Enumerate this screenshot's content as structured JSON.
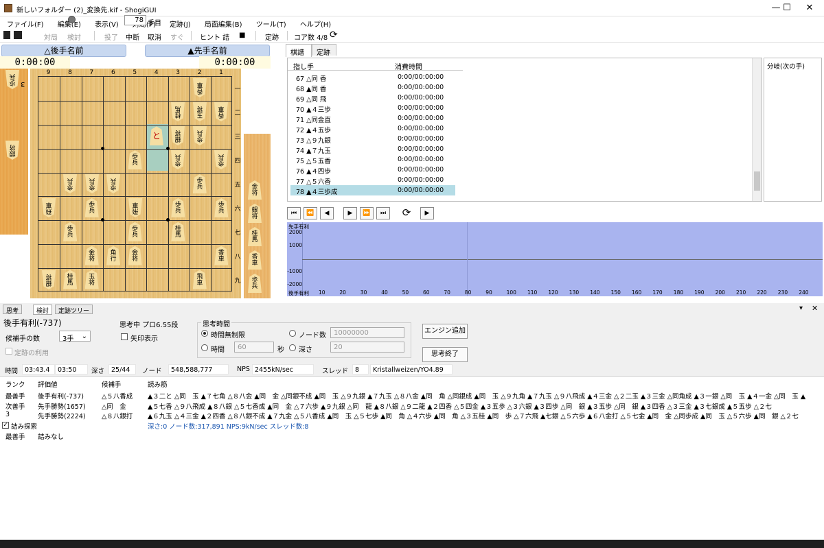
{
  "window": {
    "title": "新しいフォルダー (2)_変換先.kif - ShogiGUI",
    "minimize": "—",
    "maximize": "☐",
    "close": "✕"
  },
  "menu": [
    "ファイル(F)",
    "編集(E)",
    "表示(V)",
    "対局(P)",
    "定跡(J)",
    "局面編集(B)",
    "ツール(T)",
    "ヘルプ(H)"
  ],
  "toolbar": {
    "taikyoku": "対局",
    "kento": "検討",
    "toryo": "投了",
    "chudan": "中断",
    "torikeshi": "取消",
    "sugu": "すぐ",
    "hint": "ヒント",
    "tsume": "詰",
    "stop": "■",
    "joseki": "定跡",
    "core": "コア数 4/8"
  },
  "players": {
    "gote": "△後手名前",
    "sente": "▲先手名前",
    "gote_time": "0:00:00",
    "sente_time": "0:00:00",
    "move_number": "78",
    "move_label": "手目"
  },
  "board": {
    "columns": [
      "9",
      "8",
      "7",
      "6",
      "5",
      "4",
      "3",
      "2",
      "1"
    ],
    "rows": [
      "一",
      "二",
      "三",
      "四",
      "五",
      "六",
      "七",
      "八",
      "九"
    ],
    "pieces": [
      {
        "t": "香\n車",
        "c": 2,
        "r": 1,
        "g": true
      },
      {
        "t": "桂\n馬",
        "c": 3,
        "r": 2,
        "g": true
      },
      {
        "t": "玉\n将",
        "c": 2,
        "r": 2,
        "g": true
      },
      {
        "t": "香\n車",
        "c": 1,
        "r": 2,
        "g": true
      },
      {
        "t": "と",
        "c": 4,
        "r": 3,
        "g": false,
        "red": true
      },
      {
        "t": "銀\n将",
        "c": 3,
        "r": 3,
        "g": true
      },
      {
        "t": "歩\n兵",
        "c": 2,
        "r": 3,
        "g": true
      },
      {
        "t": "歩\n兵",
        "c": 5,
        "r": 4,
        "g": false
      },
      {
        "t": "歩\n兵",
        "c": 3,
        "r": 4,
        "g": true
      },
      {
        "t": "歩\n兵",
        "c": 1,
        "r": 4,
        "g": true
      },
      {
        "t": "歩\n兵",
        "c": 8,
        "r": 5,
        "g": true
      },
      {
        "t": "歩\n兵",
        "c": 7,
        "r": 5,
        "g": true
      },
      {
        "t": "歩\n兵",
        "c": 6,
        "r": 5,
        "g": true
      },
      {
        "t": "歩\n兵",
        "c": 2,
        "r": 5,
        "g": false
      },
      {
        "t": "飛\n車",
        "c": 9,
        "r": 6,
        "g": true
      },
      {
        "t": "歩\n兵",
        "c": 7,
        "r": 6,
        "g": false
      },
      {
        "t": "飛\n車",
        "c": 5,
        "r": 6,
        "g": true
      },
      {
        "t": "歩\n兵",
        "c": 3,
        "r": 6,
        "g": false
      },
      {
        "t": "歩\n兵",
        "c": 1,
        "r": 6,
        "g": false
      },
      {
        "t": "歩\n兵",
        "c": 8,
        "r": 7,
        "g": false
      },
      {
        "t": "歩\n兵",
        "c": 5,
        "r": 7,
        "g": false
      },
      {
        "t": "桂\n馬",
        "c": 3,
        "r": 7,
        "g": false
      },
      {
        "t": "金\n将",
        "c": 7,
        "r": 8,
        "g": false
      },
      {
        "t": "角\n行",
        "c": 6,
        "r": 8,
        "g": false
      },
      {
        "t": "金\n将",
        "c": 5,
        "r": 8,
        "g": false
      },
      {
        "t": "香\n車",
        "c": 1,
        "r": 8,
        "g": false
      },
      {
        "t": "銀\n将",
        "c": 9,
        "r": 9,
        "g": true
      },
      {
        "t": "桂\n馬",
        "c": 8,
        "r": 9,
        "g": false
      },
      {
        "t": "玉\n将",
        "c": 7,
        "r": 9,
        "g": false
      },
      {
        "t": "飛\n車",
        "c": 2,
        "r": 9,
        "g": false
      }
    ]
  },
  "hands": {
    "gote": [
      {
        "t": "歩\n兵",
        "count": "3"
      },
      {
        "t": "銀\n将",
        "count": ""
      }
    ],
    "sente": [
      {
        "t": "金\n将"
      },
      {
        "t": "銀\n将"
      },
      {
        "t": "桂\n馬"
      },
      {
        "t": "香\n車"
      },
      {
        "t": "歩\n兵"
      }
    ]
  },
  "kifu_tabs": [
    "棋譜",
    "定跡"
  ],
  "kifu_headers": {
    "move": "指し手",
    "time": "消費時間"
  },
  "kifu": [
    {
      "m": "67 △同 香",
      "t": "0:00/00:00:00"
    },
    {
      "m": "68 ▲同 香",
      "t": "0:00/00:00:00"
    },
    {
      "m": "69 △同 飛",
      "t": "0:00/00:00:00"
    },
    {
      "m": "70 ▲４三歩",
      "t": "0:00/00:00:00"
    },
    {
      "m": "71 △同金直",
      "t": "0:00/00:00:00"
    },
    {
      "m": "72 ▲４五歩",
      "t": "0:00/00:00:00"
    },
    {
      "m": "73 △９九銀",
      "t": "0:00/00:00:00"
    },
    {
      "m": "74 ▲７九玉",
      "t": "0:00/00:00:00"
    },
    {
      "m": "75 △５五香",
      "t": "0:00/00:00:00"
    },
    {
      "m": "76 ▲４四歩",
      "t": "0:00/00:00:00"
    },
    {
      "m": "77 △５六香",
      "t": "0:00/00:00:00"
    },
    {
      "m": "78 ▲４三歩成",
      "t": "0:00/00:00:00"
    }
  ],
  "branch_header": "分岐(次の手)",
  "graph": {
    "top_label": "先手有利",
    "bottom_label": "後手有利",
    "y_labels": [
      "2000",
      "1000",
      "-1000",
      "-2000"
    ],
    "x_labels": [
      "10",
      "20",
      "30",
      "40",
      "50",
      "60",
      "70",
      "80",
      "90",
      "100",
      "110",
      "120",
      "130",
      "140",
      "150",
      "160",
      "170",
      "180",
      "190",
      "200",
      "210",
      "220",
      "230",
      "240"
    ]
  },
  "bottom_tabs": [
    "思考",
    "検討",
    "定跡ツリー"
  ],
  "analysis": {
    "eval": "後手有利(-737)",
    "thinking": "思考中 プロ6.55段",
    "candidates_label": "候補手の数",
    "candidates_value": "3手",
    "arrow_label": "矢印表示",
    "joseki_use": "定跡の利用",
    "think_time_label": "思考時間",
    "unlimited": "時間無制限",
    "time": "時間",
    "time_val": "60",
    "sec": "秒",
    "nodes": "ノード数",
    "nodes_val": "10000000",
    "depth": "深さ",
    "depth_val": "20",
    "add_engine": "エンジン追加",
    "end_think": "思考終了"
  },
  "stats": {
    "time_label": "時間",
    "time": "03:43.4",
    "time2": "03:50",
    "depth_label": "深さ",
    "depth": "25/44",
    "nodes_label": "ノード数",
    "nodes": "548,588,777",
    "nps_label": "NPS",
    "nps": "2455kN/sec",
    "threads_label": "スレッド数",
    "threads": "8",
    "engine": "Kristallweizen/YO4.89"
  },
  "pv_headers": [
    "ランク",
    "評価値",
    "候補手",
    "読み筋"
  ],
  "pv": [
    {
      "rank": "最善手",
      "eval": "後手有利(-737)",
      "move": "△５八香成",
      "line": "▲３二と △同　玉 ▲７七角 △８八金 ▲同　金 △同銀不成 ▲同　玉 △９九銀 ▲７九玉 △８八金 ▲同　角 △同銀成 ▲同　玉 △９九角 ▲７九玉 △９八飛成 ▲４三金 △２二玉 ▲３三金 △同角成 ▲３一銀 △同　玉 ▲４一金 △同　玉 ▲"
    },
    {
      "rank": "次善手",
      "eval": "先手勝勢(1657)",
      "move": "△同　金",
      "line": "▲５七香 △９八飛成 ▲８八銀 △５七香成 ▲同　金 △７六歩 ▲９九銀 △同　龍 ▲８八銀 △９二龍 ▲２四香 △５四金 ▲３五歩 △３六銀 ▲３四歩 △同　銀 ▲３五歩 △同　銀 ▲３四香 △３三金 ▲３七銀成 ▲５五歩 △２七"
    },
    {
      "rank": "3",
      "eval": "先手勝勢(2224)",
      "move": "△８八銀打",
      "line": "▲６九玉 △４三金 ▲２四香 △８八銀不成 ▲７九金 △５八香成 ▲同　玉 △５七歩 ▲同　角 △４六歩 ▲同　角 △３五桂 ▲同　歩 △７六飛 ▲七銀 △５六歩 ▲６八金打 △５七金 ▲同　金 △同歩成 ▲同　玉 △５六歩 ▲同　銀 △２七"
    }
  ],
  "search_label": "詰み探索",
  "search_info": "深さ:0 ノード数:317,891 NPS:9kN/sec スレッド数:8",
  "mate_rank": "最善手",
  "mate_result": "詰みなし"
}
